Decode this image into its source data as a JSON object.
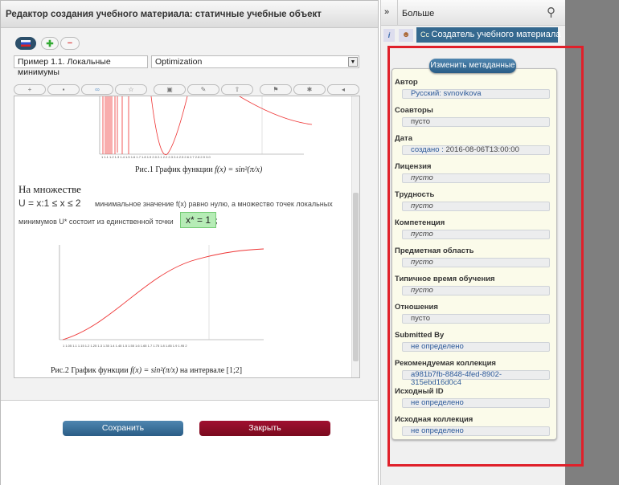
{
  "editor": {
    "title": "Редактор создания учебного материала: статичные учебные объект",
    "title_field": "Пример 1.1. Локальные минимумы",
    "category_select": "Optimization",
    "fig1_caption": "Рис.1 График функции",
    "formula": "f(x) = sin²(π/x)",
    "heading": "На множестве",
    "set_expr": "U = x:1 ≤ x ≤ 2",
    "text1": "минимальное значение f(x) равно нулю, а множество точек локальных",
    "text2": "минимумов U* состоит из единственной точки",
    "point": "x* = 1",
    "colon": ";",
    "fig2_caption": "Рис.2 График функции",
    "interval": "на интервале [1;2]"
  },
  "actions": {
    "save": "Сохранить",
    "close": "Закрыть"
  },
  "panel": {
    "title": "Больше",
    "active_tab": "Создатель учебного материала",
    "edit_meta": "Изменить метаданные"
  },
  "metadata": [
    {
      "label": "Автор",
      "prefix": "Русский:",
      "value": "svnovikova",
      "style": "blue"
    },
    {
      "label": "Соавторы",
      "value": "пусто",
      "style": ""
    },
    {
      "label": "Дата",
      "prefix": "создано :",
      "value": "2016-08-06T13:00:00",
      "style": ""
    },
    {
      "label": "Лицензия",
      "value": "пусто",
      "style": "it"
    },
    {
      "label": "Трудность",
      "value": "пусто",
      "style": "it"
    },
    {
      "label": "Компетенция",
      "value": "пусто",
      "style": "it"
    },
    {
      "label": "Предметная область",
      "value": "пусто",
      "style": "it"
    },
    {
      "label": "Типичное время обучения",
      "value": "пусто",
      "style": "it"
    },
    {
      "label": "Отношения",
      "value": "пусто",
      "style": ""
    },
    {
      "label": "Submitted By",
      "value": "не определено",
      "style": "blue"
    },
    {
      "label": "Рекомендуемая коллекция",
      "value": "a981b7fb-8848-4fed-8902-315ebd16d0c4",
      "style": "blue"
    },
    {
      "label": "Исходный ID",
      "value": "не определено",
      "style": "blue"
    },
    {
      "label": "Исходная коллекция",
      "value": "не определено",
      "style": "blue"
    }
  ],
  "colors": {
    "accent": "#2f6690",
    "close": "#8b0a22",
    "highlight": "#e0202a"
  }
}
